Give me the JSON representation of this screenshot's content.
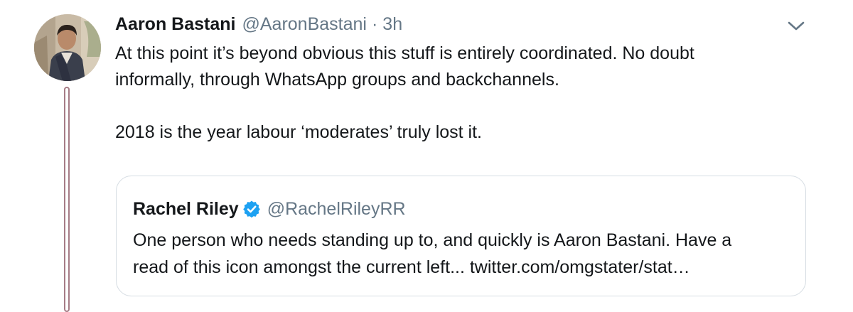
{
  "tweet": {
    "author_name": "Aaron Bastani",
    "author_handle": "@AaronBastani",
    "separator": "·",
    "timestamp": "3h",
    "body_lines": [
      "At this point it’s beyond obvious this stuff is entirely coordinated. No doubt",
      "informally, through WhatsApp groups and backchannels.",
      "2018 is the year labour ‘moderates’ truly lost it."
    ],
    "menu_icon": "chevron-down-icon"
  },
  "quoted_tweet": {
    "author_name": "Rachel Riley",
    "verified_icon": "verified-badge-icon",
    "author_handle": "@RachelRileyRR",
    "text_lines": [
      "One person who needs standing up to, and quickly is Aaron Bastani. Have a",
      "read of this icon amongst the current left... twitter.com/omgstater/stat…"
    ]
  },
  "colors": {
    "text_primary": "#14171a",
    "text_secondary": "#657786",
    "verified_blue": "#1da1f2",
    "border": "#d6dde3",
    "thread_line": "#a67c86"
  }
}
